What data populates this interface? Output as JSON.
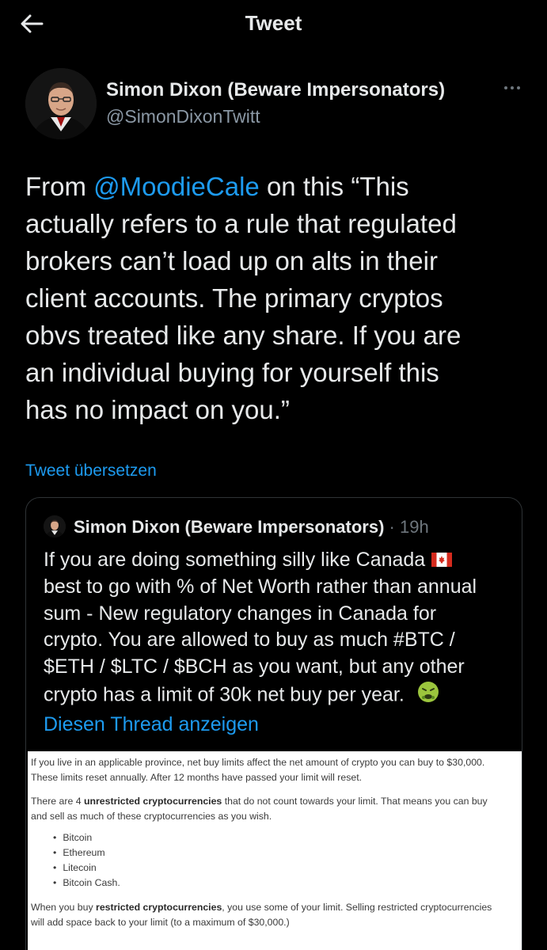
{
  "header": {
    "title": "Tweet"
  },
  "tweet": {
    "author": {
      "name": "Simon Dixon (Beware Impersonators)",
      "handle": "@SimonDixonTwitt"
    },
    "text_lines": [
      {
        "pre": "From ",
        "mention": "@MoodieCale",
        "post": "  on this “This"
      },
      "actually refers to a rule that regulated",
      "brokers can’t load up on alts in their",
      "client accounts. The primary cryptos",
      "obvs treated like any share. If you are",
      "an individual buying for yourself this",
      "has no impact on you.”"
    ],
    "translate_label": "Tweet übersetzen"
  },
  "quote": {
    "author": "Simon Dixon (Beware Impersonators)",
    "separator": " · ",
    "time": "19h",
    "text_lines": [
      "If you are doing something silly like Canada",
      "best to go with % of Net Worth rather than annual",
      "sum - New regulatory changes in Canada for",
      "crypto. You are allowed to buy as much #BTC /",
      "$ETH / $LTC / $BCH as you want, but any other",
      "crypto has a limit of 30k net buy per year. "
    ],
    "flag_icon": "canada-flag-icon",
    "nauseated_icon": "nauseated-face-icon",
    "thread_link": "Diesen Thread anzeigen",
    "image": {
      "p1_lines": [
        "If you live in an applicable province, net buy limits affect the net amount of crypto you can buy  to $30,000.",
        "These limits reset annually. After 12 months have passed your limit will reset."
      ],
      "p2_line1": {
        "pre": "There are 4 ",
        "bold": "unrestricted cryptocurrencies",
        "post": " that do not count towards your limit. That means you can buy"
      },
      "p2_line2": "and sell as much of these cryptocurrencies as you wish.",
      "coins": [
        "Bitcoin",
        "Ethereum",
        "Litecoin",
        "Bitcoin Cash."
      ],
      "p3_line1": {
        "pre": "When you buy ",
        "bold": "restricted cryptocurrencies",
        "post": ", you use some of your limit. Selling restricted cryptocurrencies"
      },
      "p3_line2": "will add space back to your limit (to a maximum of $30,000.)"
    }
  },
  "colors": {
    "background": "#000000",
    "text": "#e7e9ea",
    "muted": "#8b98a5",
    "accent": "#1d9bf0",
    "border": "#2f3336"
  }
}
